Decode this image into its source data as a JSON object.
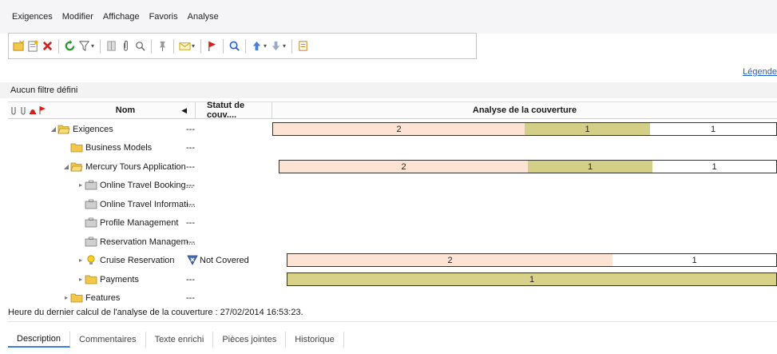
{
  "menu": [
    "Exigences",
    "Modifier",
    "Affichage",
    "Favoris",
    "Analyse"
  ],
  "legend_link": "Légende",
  "filter_text": "Aucun filtre défini",
  "columns": {
    "name": "Nom",
    "status": "Statut de couv....",
    "coverage": "Analyse de la couverture"
  },
  "colors": {
    "seg_notcovered": "#fde3d3",
    "seg_partial": "#d4cf86",
    "seg_passed": "#ffffff",
    "seg_full": "#d8d289",
    "folder": "#f3c84a",
    "link": "#1a5fd0"
  },
  "rows": [
    {
      "name": "Exigences",
      "status": "---",
      "icon": "folder-open-icon",
      "expander": "expanded"
    },
    {
      "name": "Business Models",
      "status": "---",
      "icon": "folder-icon",
      "expander": "none"
    },
    {
      "name": "Mercury Tours Application",
      "status": "---",
      "icon": "folder-open-icon",
      "expander": "expanded"
    },
    {
      "name": "Online Travel Booking...",
      "status": "---",
      "icon": "briefcase-icon",
      "expander": "collapsed"
    },
    {
      "name": "Online Travel Informati...",
      "status": "---",
      "icon": "briefcase-icon",
      "expander": "none"
    },
    {
      "name": "Profile Management",
      "status": "---",
      "icon": "briefcase-icon",
      "expander": "none"
    },
    {
      "name": "Reservation Managem...",
      "status": "---",
      "icon": "briefcase-icon",
      "expander": "none"
    },
    {
      "name": "Cruise Reservation",
      "status": "Not Covered",
      "icon": "lightbulb-icon",
      "expander": "collapsed"
    },
    {
      "name": "Payments",
      "status": "---",
      "icon": "folder-icon",
      "expander": "collapsed"
    },
    {
      "name": "Features",
      "status": "---",
      "icon": "folder-icon",
      "expander": "collapsed"
    }
  ],
  "coverage_bars": {
    "exigences": [
      2,
      1,
      1
    ],
    "mercury": [
      2,
      1,
      1
    ],
    "cruise": [
      2,
      1
    ],
    "payments": [
      1
    ]
  },
  "last_calc": "Heure du dernier calcul de l'analyse de la couverture : 27/02/2014 16:53:23.",
  "tabs": [
    "Description",
    "Commentaires",
    "Texte enrichi",
    "Pièces jointes",
    "Historique"
  ]
}
